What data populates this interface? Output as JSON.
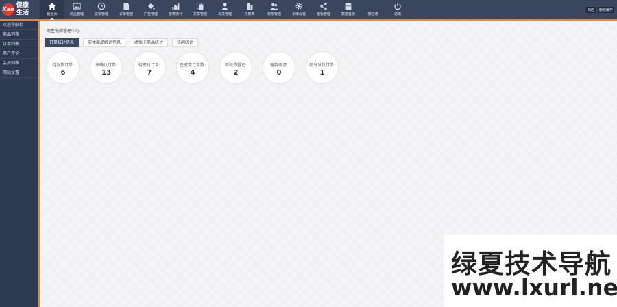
{
  "logo": {
    "mark": "Xao",
    "line1": "健康",
    "line2": "生活"
  },
  "nav": [
    {
      "label": "起始页",
      "icon": "home-icon",
      "active": true
    },
    {
      "label": "商品管理",
      "icon": "image-icon"
    },
    {
      "label": "促销管理",
      "icon": "clock-icon"
    },
    {
      "label": "订单管理",
      "icon": "document-icon"
    },
    {
      "label": "广告管理",
      "icon": "paint-bucket-icon"
    },
    {
      "label": "报表统计",
      "icon": "bar-chart-icon"
    },
    {
      "label": "文章管理",
      "icon": "copy-icon"
    },
    {
      "label": "会员管理",
      "icon": "user-icon"
    },
    {
      "label": "权限表",
      "icon": "building-icon"
    },
    {
      "label": "权限管理",
      "icon": "users-icon"
    },
    {
      "label": "系统设置",
      "icon": "gear-icon"
    },
    {
      "label": "模板管理",
      "icon": "share-icon"
    },
    {
      "label": "数据备份",
      "icon": "database-icon"
    },
    {
      "label": "微信通",
      "icon": "blank-icon"
    },
    {
      "label": "退出",
      "icon": "power-icon"
    }
  ],
  "top_right": {
    "link1": "商店",
    "link2": "删除缓存"
  },
  "sidebar": {
    "items": [
      {
        "label": "欢迎导航栏"
      },
      {
        "label": "商品列表"
      },
      {
        "label": "订单列表"
      },
      {
        "label": "用户评论"
      },
      {
        "label": "会员列表"
      },
      {
        "label": "网站设置"
      }
    ]
  },
  "main": {
    "title": "商生电商管理中心",
    "tabs": [
      {
        "label": "订单统计信息",
        "active": true
      },
      {
        "label": "实体商品统计信息"
      },
      {
        "label": "虚拟卡商品统计"
      },
      {
        "label": "访问统计"
      }
    ],
    "stats": [
      {
        "label": "待发货订单:",
        "value": "6"
      },
      {
        "label": "未确认订单:",
        "value": "13"
      },
      {
        "label": "待支付订单:",
        "value": "7"
      },
      {
        "label": "已成交订单数:",
        "value": "4"
      },
      {
        "label": "新缺货登记:",
        "value": "2"
      },
      {
        "label": "退款申请:",
        "value": "0"
      },
      {
        "label": "部分发货订单:",
        "value": "1"
      }
    ]
  },
  "watermark": {
    "line1": "绿夏技术导航",
    "line2": "www.lxurl.net"
  }
}
